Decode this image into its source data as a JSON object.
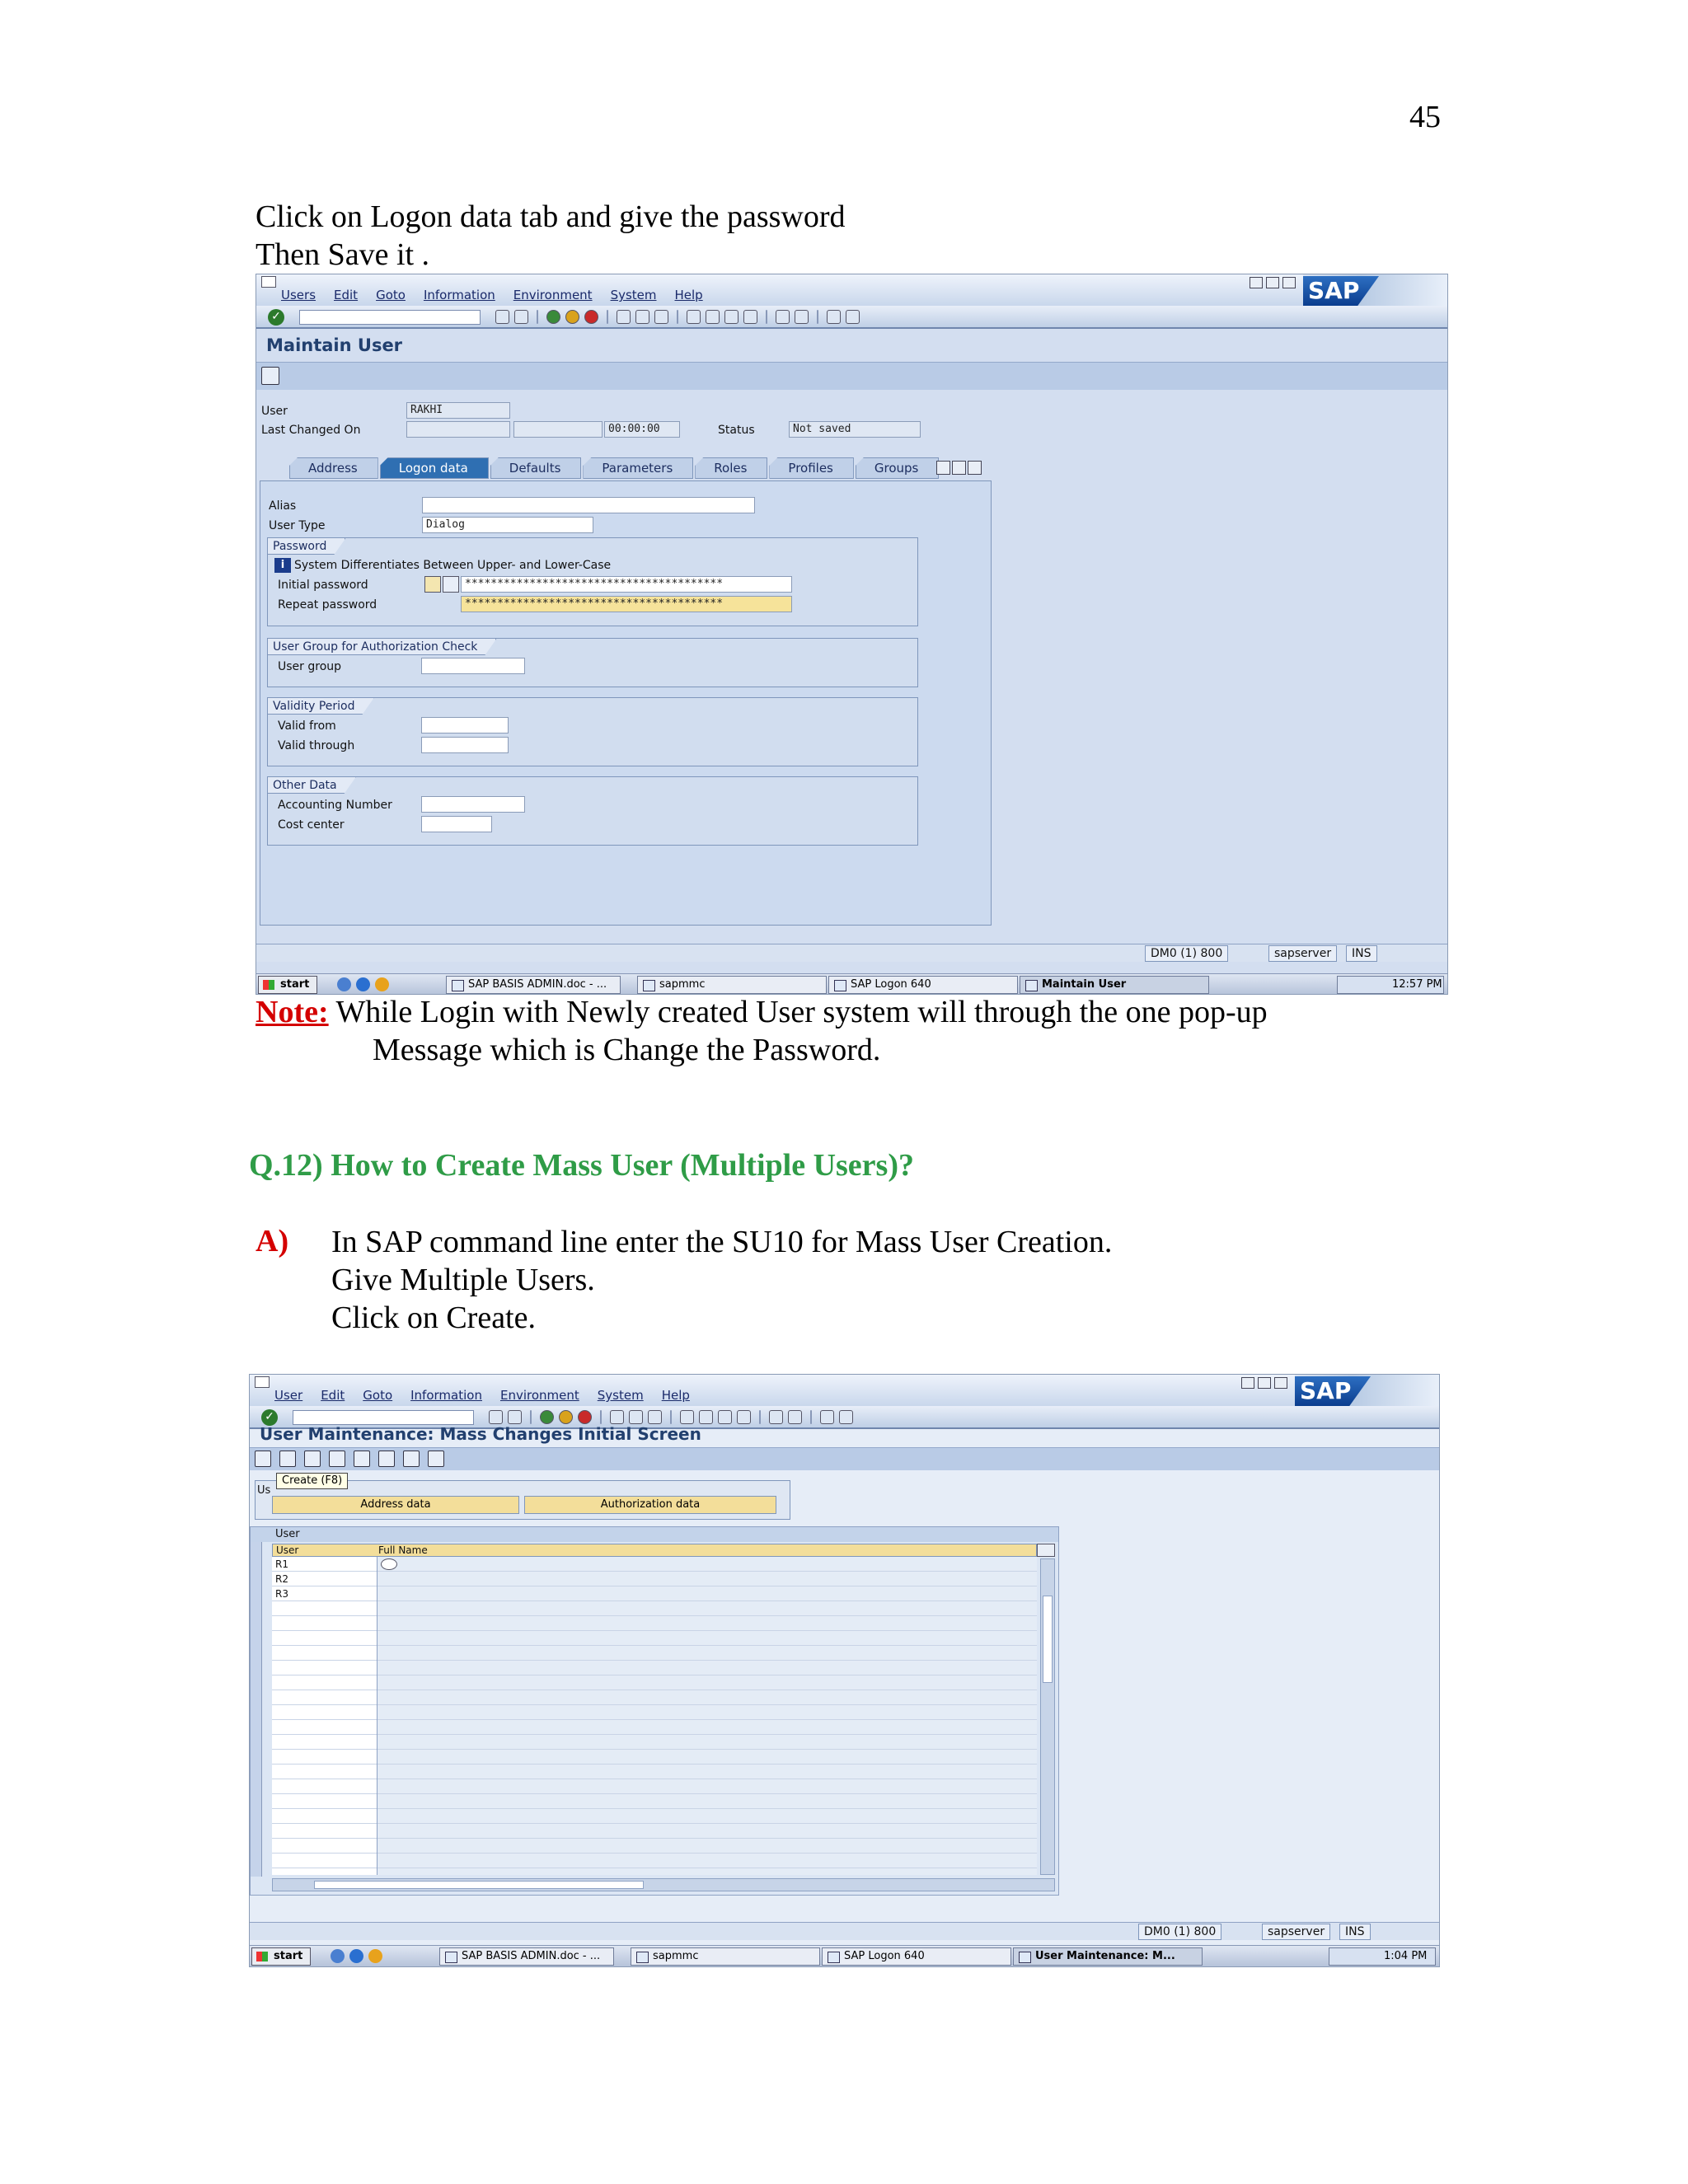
{
  "page_number": "45",
  "intro": {
    "line1": "Click on Logon data tab and give the password",
    "line2": "Then Save it ."
  },
  "note": {
    "label": "Note:",
    "line1": " While Login with Newly created User system will through the one pop-up",
    "line2": "Message which is Change the Password."
  },
  "question": {
    "heading": "Q.12) How to Create Mass User (Multiple Users)?",
    "answer_label": "A)",
    "answer_lines": [
      "In SAP command line enter the SU10 for Mass User Creation.",
      "Give Multiple Users.",
      "Click on Create."
    ]
  },
  "screenshot1": {
    "menu": [
      "Users",
      "Edit",
      "Goto",
      "Information",
      "Environment",
      "System",
      "Help"
    ],
    "logo_text": "SAP",
    "screen_title": "Maintain User",
    "user_label": "User",
    "user_value": "RAKHI",
    "last_changed_label": "Last Changed On",
    "time_value": "00:00:00",
    "status_label": "Status",
    "status_value": "Not saved",
    "tabs": [
      "Address",
      "Logon data",
      "Defaults",
      "Parameters",
      "Roles",
      "Profiles",
      "Groups"
    ],
    "alias_label": "Alias",
    "user_type_label": "User Type",
    "user_type_value": "Dialog",
    "password_group": "Password",
    "case_note": "System Differentiates Between Upper- and Lower-Case",
    "initial_password_label": "Initial password",
    "initial_password_value": "****************************************",
    "repeat_password_label": "Repeat password",
    "repeat_password_value": "****************************************",
    "user_group_title": "User Group for Authorization Check",
    "user_group_label": "User group",
    "validity_title": "Validity Period",
    "valid_from_label": "Valid from",
    "valid_through_label": "Valid through",
    "other_title": "Other Data",
    "accounting_label": "Accounting Number",
    "cost_center_label": "Cost center",
    "status_system": "DM0 (1) 800",
    "status_server": "sapserver",
    "status_mode": "INS",
    "taskbar": {
      "start": "start",
      "tasks": [
        "SAP BASIS ADMIN.doc - ...",
        "sapmmc",
        "SAP Logon 640",
        "Maintain User"
      ],
      "time": "12:57 PM"
    }
  },
  "screenshot2": {
    "menu": [
      "User",
      "Edit",
      "Goto",
      "Information",
      "Environment",
      "System",
      "Help"
    ],
    "logo_text": "SAP",
    "screen_title": "User Maintenance: Mass Changes Initial Screen",
    "tooltip": "Create   (F8)",
    "group_prefix": "Us",
    "address_button": "Address data",
    "auth_button": "Authorization data",
    "table_title": "User",
    "col_user": "User",
    "col_fullname": "Full Name",
    "rows": [
      "R1",
      "R2",
      "R3"
    ],
    "status_system": "DM0 (1) 800",
    "status_server": "sapserver",
    "status_mode": "INS",
    "taskbar": {
      "start": "start",
      "tasks": [
        "SAP BASIS ADMIN.doc - ...",
        "sapmmc",
        "SAP Logon 640",
        "User Maintenance: M..."
      ],
      "time": "1:04 PM"
    }
  },
  "colors": {
    "note_red": "#d40000",
    "question_green": "#2f9c47",
    "sap_blue": "#22406f"
  },
  "icons": [
    "enter-check-icon",
    "save-icon",
    "back-icon",
    "exit-icon",
    "cancel-icon",
    "print-icon",
    "find-icon",
    "help-icon",
    "sap-logo",
    "info-icon",
    "create-icon",
    "change-icon",
    "display-icon"
  ]
}
